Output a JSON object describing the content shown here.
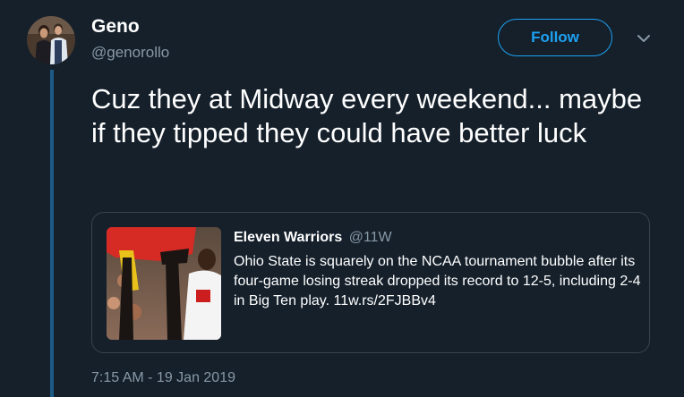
{
  "author": {
    "display_name": "Geno",
    "handle": "@genorollo"
  },
  "actions": {
    "follow_label": "Follow"
  },
  "tweet": {
    "text": "Cuz they at Midway every weekend... maybe if they tipped they could have better luck",
    "timestamp": "7:15 AM - 19 Jan 2019"
  },
  "quoted_tweet": {
    "display_name": "Eleven Warriors",
    "handle": "@11W",
    "text": "Ohio State is squarely on the NCAA tournament bubble after its four-game losing streak dropped its record to 12-5, including 2-4 in Big Ten play. 11w.rs/2FJBBv4"
  },
  "icons": {
    "menu": "chevron-down-icon"
  },
  "colors": {
    "background": "#15202b",
    "accent": "#1da1f2",
    "secondary_text": "#8899a6",
    "thread_line": "#1d5a86",
    "card_border": "#38444d"
  }
}
